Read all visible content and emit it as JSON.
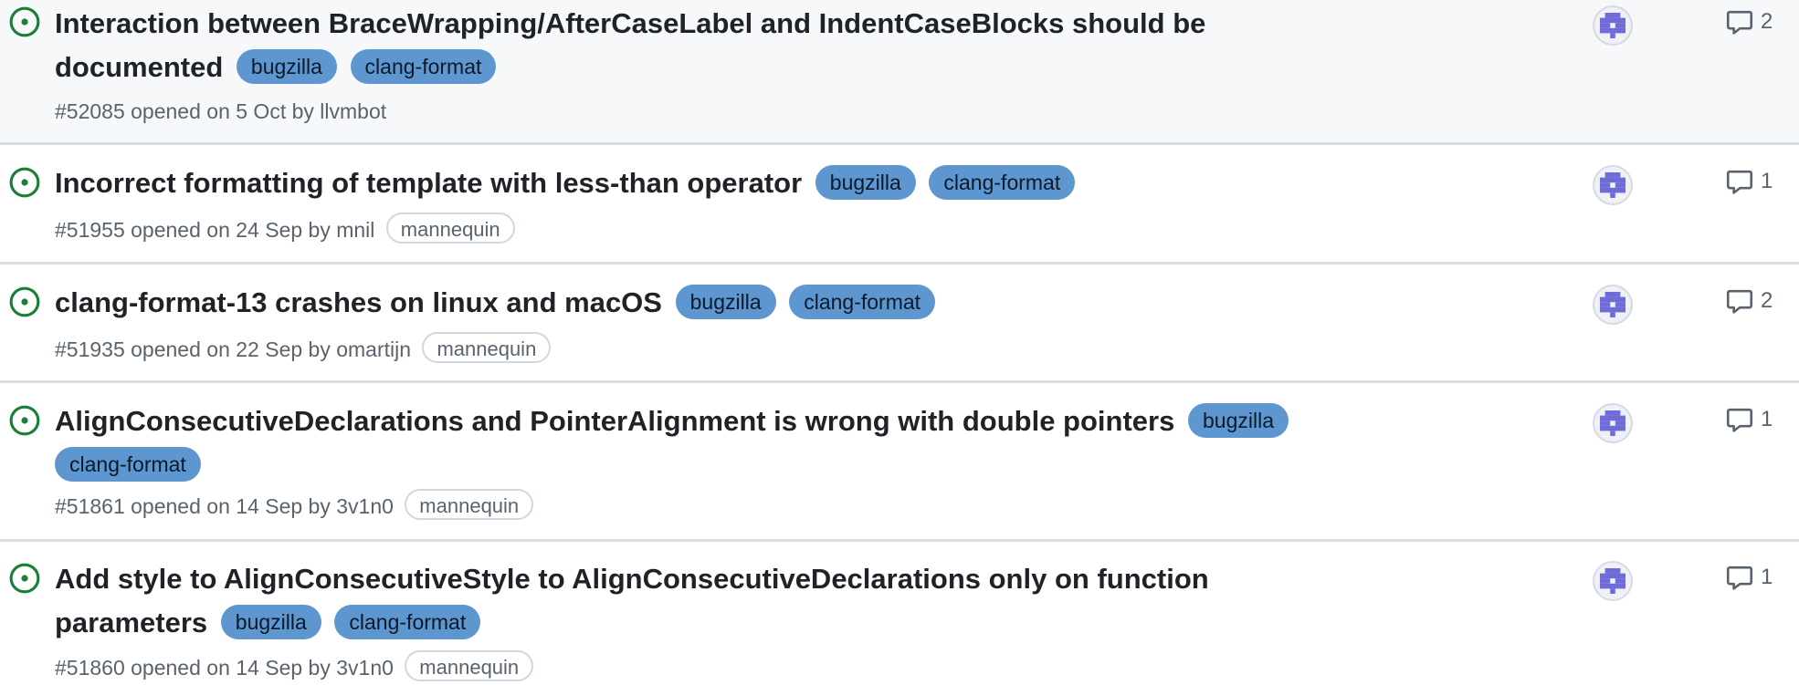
{
  "colors": {
    "open_status": "#1a7f37",
    "label_bg": "#5e96cf",
    "avatar_fg": "#6f6bd8",
    "row_border": "#d8dee4"
  },
  "icons": {
    "status": "issue-opened-icon",
    "comments": "comment-icon",
    "avatar": "identicon-avatar"
  },
  "issues": [
    {
      "title_part1": "Interaction between BraceWrapping/AfterCaseLabel and IndentCaseBlocks should be",
      "title_part2": "documented",
      "labels": [
        "bugzilla",
        "clang-format"
      ],
      "number": "#52085",
      "opened_text": "opened on 5 Oct by",
      "author": "llvmbot",
      "badge": "",
      "comments": "2"
    },
    {
      "title": "Incorrect formatting of template with less-than operator",
      "labels": [
        "bugzilla",
        "clang-format"
      ],
      "number": "#51955",
      "opened_text": "opened on 24 Sep by",
      "author": "mnil",
      "badge": "mannequin",
      "comments": "1"
    },
    {
      "title": "clang-format-13 crashes on linux and macOS",
      "labels": [
        "bugzilla",
        "clang-format"
      ],
      "number": "#51935",
      "opened_text": "opened on 22 Sep by",
      "author": "omartijn",
      "badge": "mannequin",
      "comments": "2"
    },
    {
      "title": "AlignConsecutiveDeclarations and PointerAlignment is wrong with double pointers",
      "labels": [
        "bugzilla",
        "clang-format"
      ],
      "number": "#51861",
      "opened_text": "opened on 14 Sep by",
      "author": "3v1n0",
      "badge": "mannequin",
      "comments": "1"
    },
    {
      "title_part1": "Add style to AlignConsecutiveStyle to AlignConsecutiveDeclarations only on function",
      "title_part2": "parameters",
      "labels": [
        "bugzilla",
        "clang-format"
      ],
      "number": "#51860",
      "opened_text": "opened on 14 Sep by",
      "author": "3v1n0",
      "badge": "mannequin",
      "comments": "1"
    }
  ]
}
